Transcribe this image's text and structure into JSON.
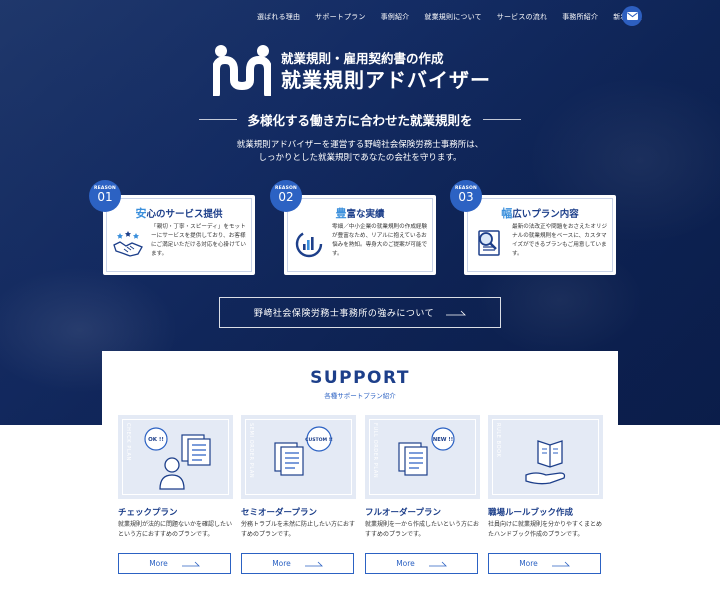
{
  "nav": {
    "items": [
      "選ばれる理由",
      "サポートプラン",
      "事例紹介",
      "就業規則について",
      "サービスの流れ",
      "事務所紹介",
      "新着情報"
    ],
    "mail_icon": "envelope-icon"
  },
  "logo": {
    "sub": "就業規則・雇用契約書の作成",
    "main": "就業規則アドバイザー"
  },
  "hero": {
    "tagline": "多様化する働き方に合わせた就業規則を",
    "intro_line1": "就業規則アドバイザーを運営する野﨑社会保険労務士事務所は、",
    "intro_line2": "しっかりとした就業規則であなたの会社を守ります。"
  },
  "reasons": [
    {
      "label": "REASON",
      "num": "01",
      "title_hl": "安",
      "title_rest": "心のサービス提供",
      "text": "「親切・丁寧・スピーディ」をモットーにサービスを提供しており、お客様にご満足いただける対応を心掛けています。",
      "icon": "handshake-icon"
    },
    {
      "label": "REASON",
      "num": "02",
      "title_hl": "豊",
      "title_rest": "富な実績",
      "text": "零細／中小企業の就業規則の作成経験が豊富なため、リアルに抱えているお悩みを熟知。専身大のご提案が可能です。",
      "icon": "chart-icon"
    },
    {
      "label": "REASON",
      "num": "03",
      "title_hl": "幅",
      "title_rest": "広いプラン内容",
      "text": "最新の法改正や問題をおさえたオリジナルの就業規則をベースに、カスタマイズができるプランもご用意しています。",
      "icon": "document-search-icon"
    }
  ],
  "strength_button": "野﨑社会保険労務士事務所の強みについて",
  "support": {
    "title": "SUPPORT",
    "subtitle": "各種サポートプラン紹介"
  },
  "plans": [
    {
      "vlabel": "CHECK PLAN",
      "bubble": "OK !!",
      "name": "チェックプラン",
      "desc": "就業規則が法的に問題ないかを確認したいという方におすすめのプランです。",
      "more": "More",
      "icon": "person-check-icon"
    },
    {
      "vlabel": "SEMI ORDER PLAN",
      "bubble": "CUSTOM !!",
      "name": "セミオーダープラン",
      "desc": "労務トラブルを未然に防止したい方におすすめのプランです。",
      "more": "More",
      "icon": "document-custom-icon"
    },
    {
      "vlabel": "FULL ORDER PLAN",
      "bubble": "NEW !!",
      "name": "フルオーダープラン",
      "desc": "就業規則を一から作成したいという方におすすめのプランです。",
      "more": "More",
      "icon": "document-new-icon"
    },
    {
      "vlabel": "RULE BOOK",
      "bubble": "",
      "name": "職場ルールブック作成",
      "desc": "社員向けに就業規則を分かりやすくまとめたハンドブック作成のプランです。",
      "more": "More",
      "icon": "book-hand-icon"
    }
  ],
  "colors": {
    "navy": "#1d3f8a",
    "accent": "#2c62c3",
    "light_blue": "#3a8fdc",
    "card_bg": "#e4eaf5"
  }
}
